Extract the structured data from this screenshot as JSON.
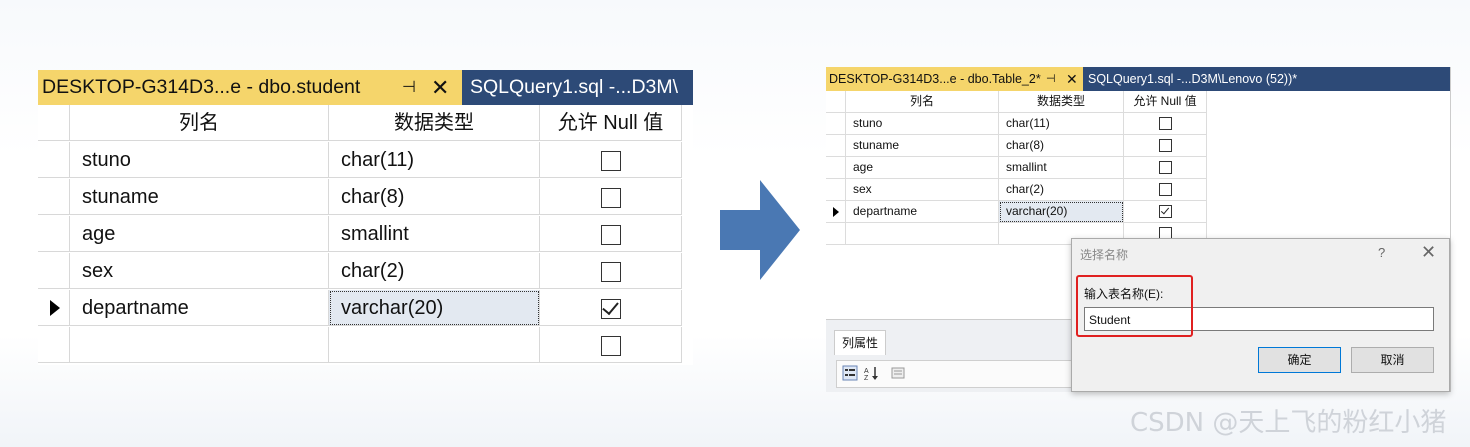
{
  "left": {
    "tab_active": "DESKTOP-G314D3...e - dbo.student",
    "pin_glyph": "⊣",
    "close_glyph": "✕",
    "tab_inactive": "SQLQuery1.sql -...D3M\\",
    "headers": [
      "列名",
      "数据类型",
      "允许 Null 值"
    ],
    "rows": [
      {
        "name": "stuno",
        "type": "char(11)",
        "nullable": false
      },
      {
        "name": "stuname",
        "type": "char(8)",
        "nullable": false
      },
      {
        "name": "age",
        "type": "smallint",
        "nullable": false
      },
      {
        "name": "sex",
        "type": "char(2)",
        "nullable": false
      },
      {
        "name": "departname",
        "type": "varchar(20)",
        "nullable": true
      },
      {
        "name": "",
        "type": "",
        "nullable": false
      }
    ]
  },
  "right": {
    "tab_active": "DESKTOP-G314D3...e - dbo.Table_2*",
    "pin_glyph": "⊣",
    "close_glyph": "✕",
    "tab_inactive": "SQLQuery1.sql -...D3M\\Lenovo (52))*",
    "headers": [
      "列名",
      "数据类型",
      "允许 Null 值"
    ],
    "rows": [
      {
        "name": "stuno",
        "type": "char(11)",
        "nullable": false
      },
      {
        "name": "stuname",
        "type": "char(8)",
        "nullable": false
      },
      {
        "name": "age",
        "type": "smallint",
        "nullable": false
      },
      {
        "name": "sex",
        "type": "char(2)",
        "nullable": false
      },
      {
        "name": "departname",
        "type": "varchar(20)",
        "nullable": true
      },
      {
        "name": "",
        "type": "",
        "nullable": false
      }
    ],
    "properties_tab": "列属性"
  },
  "dialog": {
    "title": "选择名称",
    "help": "?",
    "close": "✕",
    "label": "输入表名称(E):",
    "value": "Student",
    "ok": "确定",
    "cancel": "取消"
  },
  "watermark": "CSDN @天上飞的粉红小猪",
  "colors": {
    "active_tab": "#f5d56b",
    "inactive_tab": "#2d4a77",
    "arrow": "#4a78b3",
    "highlight": "#e02020"
  }
}
